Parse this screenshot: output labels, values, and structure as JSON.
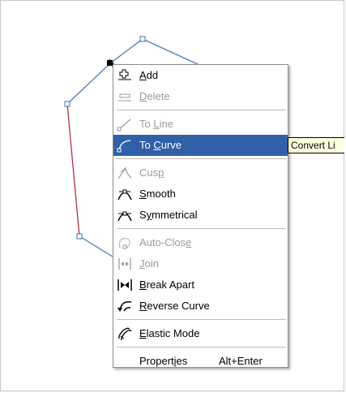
{
  "context_menu": {
    "items": [
      {
        "label": "Add",
        "mnemonic": "A",
        "rest": "dd",
        "icon": "add-node-icon",
        "disabled": false
      },
      {
        "label": "Delete",
        "mnemonic": "D",
        "rest": "elete",
        "icon": "delete-node-icon",
        "disabled": true
      },
      {
        "label": "To Line",
        "pre": "To ",
        "mnemonic": "L",
        "rest": "ine",
        "icon": "to-line-icon",
        "disabled": true
      },
      {
        "label": "To Curve",
        "pre": "To ",
        "mnemonic": "C",
        "rest": "urve",
        "icon": "to-curve-icon",
        "selected": true
      },
      {
        "label": "Cusp",
        "pre": "Cus",
        "mnemonic": "p",
        "rest": "",
        "icon": "cusp-icon",
        "disabled": true
      },
      {
        "label": "Smooth",
        "mnemonic": "S",
        "rest": "mooth",
        "icon": "smooth-icon"
      },
      {
        "label": "Symmetrical",
        "pre": "S",
        "mnemonic": "y",
        "rest": "mmetrical",
        "icon": "symmetrical-icon"
      },
      {
        "label": "Auto-Close",
        "pre": "Auto-Clos",
        "mnemonic": "e",
        "rest": "",
        "icon": "auto-close-icon",
        "disabled": true
      },
      {
        "label": "Join",
        "mnemonic": "J",
        "rest": "oin",
        "icon": "join-icon",
        "disabled": true
      },
      {
        "label": "Break Apart",
        "mnemonic": "B",
        "rest": "reak Apart",
        "icon": "break-apart-icon"
      },
      {
        "label": "Reverse Curve",
        "mnemonic": "R",
        "rest": "everse Curve",
        "icon": "reverse-curve-icon"
      },
      {
        "label": "Elastic Mode",
        "mnemonic": "E",
        "rest": "lastic Mode",
        "icon": "elastic-mode-icon"
      },
      {
        "label": "Properties",
        "pre": "Propert",
        "mnemonic": "i",
        "rest": "es",
        "shortcut": "Alt+Enter"
      }
    ]
  },
  "tooltip": {
    "text": "Convert Li"
  },
  "colors": {
    "selection": "#3160a8",
    "disabled_text": "#9a9a9a",
    "tooltip_bg": "#ffffe1",
    "curve_blue": "#4a7fb8",
    "curve_red": "#b03040"
  }
}
